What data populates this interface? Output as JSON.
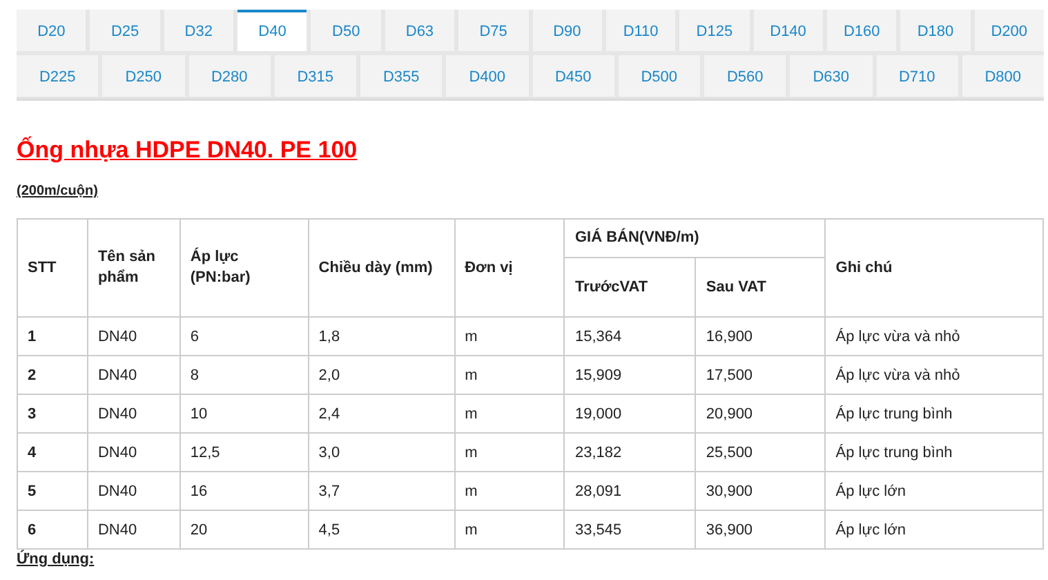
{
  "size_tabs": [
    [
      {
        "label": "D20",
        "selected": false
      },
      {
        "label": "D25",
        "selected": false
      },
      {
        "label": "D32",
        "selected": false
      },
      {
        "label": "D40",
        "selected": true
      },
      {
        "label": "D50",
        "selected": false
      },
      {
        "label": "D63",
        "selected": false
      },
      {
        "label": "D75",
        "selected": false
      },
      {
        "label": "D90",
        "selected": false
      },
      {
        "label": "D110",
        "selected": false
      },
      {
        "label": "D125",
        "selected": false
      },
      {
        "label": "D140",
        "selected": false
      },
      {
        "label": "D160",
        "selected": false
      },
      {
        "label": "D180",
        "selected": false
      },
      {
        "label": "D200",
        "selected": false
      }
    ],
    [
      {
        "label": "D225",
        "selected": false
      },
      {
        "label": "D250",
        "selected": false
      },
      {
        "label": "D280",
        "selected": false
      },
      {
        "label": "D315",
        "selected": false
      },
      {
        "label": "D355",
        "selected": false
      },
      {
        "label": "D400",
        "selected": false
      },
      {
        "label": "D450",
        "selected": false
      },
      {
        "label": "D500",
        "selected": false
      },
      {
        "label": "D560",
        "selected": false
      },
      {
        "label": "D630",
        "selected": false
      },
      {
        "label": "D710",
        "selected": false
      },
      {
        "label": "D800",
        "selected": false
      }
    ]
  ],
  "title": "Ống nhựa HDPE DN40. PE 100",
  "subtitle": "(200m/cuộn)",
  "table": {
    "columns": [
      "STT",
      "Tên sản phẩm",
      "Áp lực (PN:bar)",
      "Chiều dày (mm)",
      "Đơn vị"
    ],
    "price_group": "GIÁ BÁN(VNĐ/m)",
    "price_columns": [
      "TrướcVAT",
      "Sau VAT"
    ],
    "note_column": "Ghi chú",
    "rows": [
      [
        "1",
        "DN40",
        "6",
        "1,8",
        "m",
        "15,364",
        "16,900",
        "Áp lực vừa và nhỏ"
      ],
      [
        "2",
        "DN40",
        "8",
        "2,0",
        "m",
        "15,909",
        "17,500",
        "Áp lực vừa và nhỏ"
      ],
      [
        "3",
        "DN40",
        "10",
        "2,4",
        "m",
        "19,000",
        "20,900",
        "Áp lực trung bình"
      ],
      [
        "4",
        "DN40",
        "12,5",
        "3,0",
        "m",
        "23,182",
        "25,500",
        "Áp lực trung bình"
      ],
      [
        "5",
        "DN40",
        "16",
        "3,7",
        "m",
        "28,091",
        "30,900",
        "Áp lực lớn"
      ],
      [
        "6",
        "DN40",
        "20",
        "4,5",
        "m",
        "33,545",
        "36,900",
        "Áp lực lớn"
      ]
    ]
  },
  "footer_heading": "Ứng dụng:"
}
